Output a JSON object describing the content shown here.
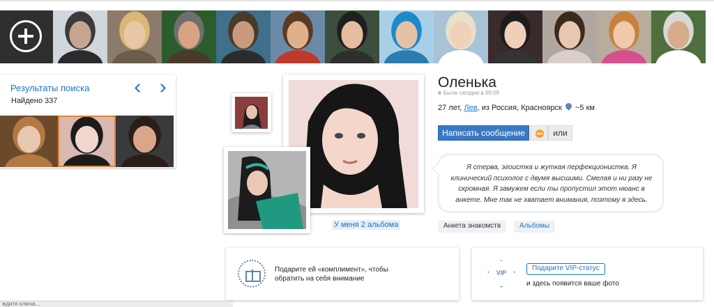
{
  "strip": {
    "add_icon": "plus-circle-icon",
    "photos": [
      {
        "skin": "#c7a48e",
        "hair": "#3a3a3a",
        "bg": "#cfd6dd",
        "body": "#2b2b2b"
      },
      {
        "skin": "#e8c7a9",
        "hair": "#d9b774",
        "bg": "#8c7b6a",
        "body": "#6b5c4c"
      },
      {
        "skin": "#d7a383",
        "hair": "#6e6e6e",
        "bg": "#2c5b2c",
        "body": "#4a3a2c"
      },
      {
        "skin": "#c99a7d",
        "hair": "#4a3a2a",
        "bg": "#3f6f8a",
        "body": "#2c2c2c"
      },
      {
        "skin": "#e0b08c",
        "hair": "#5a3a22",
        "bg": "#6b8aa8",
        "body": "#c0392b"
      },
      {
        "skin": "#e5bda0",
        "hair": "#1f1f1f",
        "bg": "#3c4f3c",
        "body": "#2f2f2f"
      },
      {
        "skin": "#e7c1a4",
        "hair": "#1c8ac9",
        "bg": "#a7cfe8",
        "body": "#2c7cb0"
      },
      {
        "skin": "#f0d2bc",
        "hair": "#e8e0c8",
        "bg": "#a8c2d8",
        "body": "#ffffff"
      },
      {
        "skin": "#f0cfb8",
        "hair": "#1c1c1c",
        "bg": "#3a2a2a",
        "body": "#333333"
      },
      {
        "skin": "#e8c7b1",
        "hair": "#3a2a1c",
        "bg": "#b0a7a0",
        "body": "#d8d0c8"
      },
      {
        "skin": "#f0c9ad",
        "hair": "#c8813c",
        "bg": "#b8ad9c",
        "body": "#d84f8f"
      },
      {
        "skin": "#d8ab8b",
        "hair": "#d8d8d8",
        "bg": "#4f6f3f",
        "body": "#ffffff"
      }
    ]
  },
  "search": {
    "title": "Результаты поиска",
    "found": "Найдено 337",
    "prev_icon": "chevron-left-icon",
    "next_icon": "chevron-right-icon",
    "results": [
      {
        "skin": "#e8c7b0",
        "hair": "#b27a42",
        "bg": "#6b4a2c",
        "selected": false
      },
      {
        "skin": "#f0d6cc",
        "hair": "#1c1c1c",
        "bg": "#d8b8b0",
        "selected": true
      },
      {
        "skin": "#d9a68a",
        "hair": "#2a1f18",
        "bg": "#3a3a3a",
        "selected": false
      }
    ]
  },
  "profile": {
    "name": "Оленька",
    "last_seen": "Была сегодня в 09:09",
    "age": "27 лет,",
    "sign": "Лев",
    "origin": "из Россия, Красноярск",
    "distance": "~5 км",
    "message_button": "Написать сообщение",
    "gift_icon": "gift-coin-icon",
    "or_button": "или",
    "about": "Я стерва, эгоистка и жуткая перфекционистка. Я клинический психолог с двумя высшими. Смелая и ни разу не скромная. Я замужем если ты пропустил этот нюанс в анкете. Мне так не хватает внимания, поэтому я здесь.",
    "albums_link": "У меня 2 альбома",
    "tab_anketa": "Анкета знакомств",
    "tab_albums": "Альбомы"
  },
  "promo": {
    "gift_text_1": "Подарите ей «комплимент», чтобы",
    "gift_text_2": "обратить на себя внимание",
    "vip_label": "VIP",
    "vip_button": "Подарите VIP-статус",
    "vip_caption": "и здесь появится ваше фото"
  },
  "statusbar": {
    "text": "ждите ключа..."
  }
}
